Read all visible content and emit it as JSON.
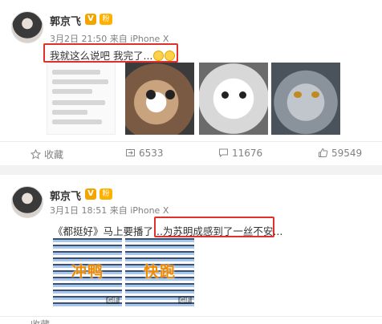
{
  "posts": [
    {
      "user": {
        "name": "郭京飞",
        "vip_badge": "V",
        "fan_badge": "粉"
      },
      "meta": {
        "time": "3月2日 21:50",
        "source": "来自 iPhone X"
      },
      "text": "我就这么说吧 我完了...",
      "actions": {
        "favorite": "收藏",
        "repost": "6533",
        "comment": "11676",
        "like": "59549"
      }
    },
    {
      "user": {
        "name": "郭京飞",
        "vip_badge": "V",
        "fan_badge": "粉"
      },
      "meta": {
        "time": "3月1日 18:51",
        "source": "来自 iPhone X"
      },
      "text_before": "《都挺好》马上要播了...",
      "text_highlighted": "为苏明成感到了一丝不安...",
      "gifs": [
        {
          "caption": "冲鸭",
          "tag": "GIF"
        },
        {
          "caption": "快跑",
          "tag": "GIF"
        }
      ],
      "actions": {
        "favorite": "收藏"
      }
    }
  ],
  "colors": {
    "highlight": "#e0302c",
    "accent": "#f2a400"
  }
}
